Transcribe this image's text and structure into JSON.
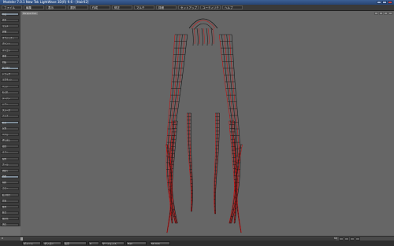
{
  "window": {
    "title": "Modeler 7.0.1 New Tek LightWave 3D(R) 9.6 - [Hair02]"
  },
  "menubar": {
    "items": [
      "ファイル",
      "編集",
      "表示",
      "選択",
      "作成",
      "修正",
      "マルチ",
      "詳細",
      "セットアップ",
      "ユーティリティ",
      "ヘルプ"
    ]
  },
  "sidebar": {
    "buttons": [
      "作成",
      "修正",
      "マルチ",
      "詳細",
      "オブジェクト",
      "ポイント",
      "ポリゴン",
      "移動",
      "回転",
      "拡大縮小",
      "ドラッグ",
      "マグネット",
      "ベンド",
      "ねじれ",
      "テーパー",
      "シアー",
      "スムーズ",
      "ナイフ",
      "結合",
      "分割",
      "ベベル",
      "押し出し",
      "旋回",
      "ミラー",
      "配列",
      "ブール",
      "面取り",
      "曲面",
      "削除",
      "コピー",
      "貼り付け",
      "反転",
      "整列",
      "統合",
      "細分化",
      "頂点",
      "UV"
    ]
  },
  "viewport": {
    "label": "Perspective",
    "colors": {
      "background": "#666666",
      "wire_dark": "#1a1a1a",
      "wire_red": "#c81414"
    }
  },
  "timeline": {
    "start": "0",
    "end": "60"
  },
  "statusbar": {
    "items": [
      "ポイント",
      "ポリゴン",
      "表示",
      "0",
      "サーフェイス",
      "Hair",
      "50 mm"
    ]
  }
}
